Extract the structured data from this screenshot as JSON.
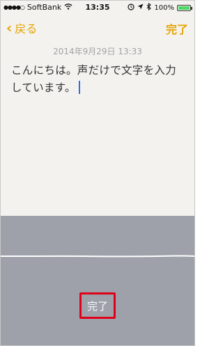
{
  "status": {
    "carrier": "SoftBank",
    "time": "13:35",
    "battery": "100%",
    "signal_dots": "●●●●○",
    "wifi_icon": "wifi-icon",
    "alarm_icon": "alarm-icon",
    "location_icon": "location-icon",
    "bluetooth_icon": "bluetooth-icon"
  },
  "nav": {
    "back_label": "戻る",
    "done_label": "完了"
  },
  "note": {
    "date": "2014年9月29日 13:33",
    "body": "こんにちは。声だけで文字を入力しています。"
  },
  "dictation": {
    "done_label": "完了"
  },
  "colors": {
    "accent": "#e5a400",
    "highlight": "#e0001a",
    "dictation_bg": "#9ea1aa"
  }
}
